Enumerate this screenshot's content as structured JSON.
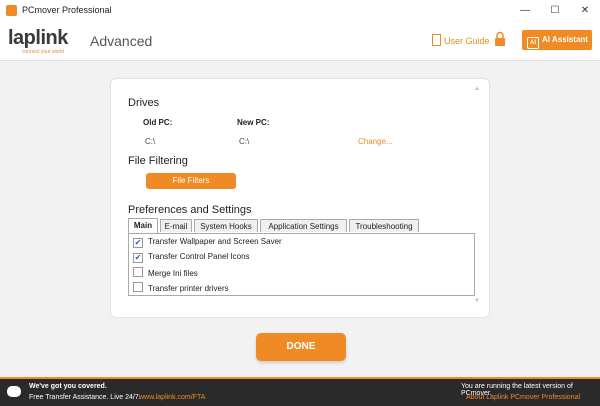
{
  "window": {
    "title": "PCmover Professional",
    "minimize": "—",
    "maximize": "☐",
    "close": "✕"
  },
  "header": {
    "logo": "laplink",
    "logo_tagline": "connect your world",
    "page_title": "Advanced",
    "user_guide": "User Guide",
    "ai_assistant": "AI Assistant",
    "ai_icon": "AI"
  },
  "drives": {
    "heading": "Drives",
    "old_pc_label": "Old PC:",
    "new_pc_label": "New PC:",
    "old_pc_value": "C:\\",
    "new_pc_value": "C:\\",
    "change_link": "Change..."
  },
  "file_filtering": {
    "heading": "File Filtering",
    "button": "File Filters"
  },
  "preferences": {
    "heading": "Preferences and Settings",
    "tabs": [
      "Main",
      "E-mail",
      "System Hooks",
      "Application Settings",
      "Troubleshooting"
    ],
    "options": [
      {
        "label": "Transfer Wallpaper and Screen Saver",
        "checked": true,
        "mark": "✔"
      },
      {
        "label": "Transfer Control Panel Icons",
        "checked": true,
        "mark": "✔"
      },
      {
        "label": "Merge Ini files",
        "checked": false,
        "mark": ""
      },
      {
        "label": "Transfer printer drivers",
        "checked": false,
        "mark": ""
      }
    ]
  },
  "done_button": "DONE",
  "footer": {
    "headline": "We've got you covered.",
    "subline": "Free Transfer Assistance. Live 24/7.",
    "link": "www.laplink.com/FTA",
    "status": "You are running the latest version of PCmover.",
    "about": "About Laplink PCmover Professional"
  },
  "colors": {
    "accent": "#f08a24",
    "footer_bg": "#2a2a2a",
    "check": "#2a62c9"
  },
  "icons": {
    "app": "pcmover-app-icon",
    "user_guide": "document-icon",
    "lock": "lock-icon",
    "ai": "ai-chip-icon",
    "chat": "chat-bubble-icon"
  }
}
